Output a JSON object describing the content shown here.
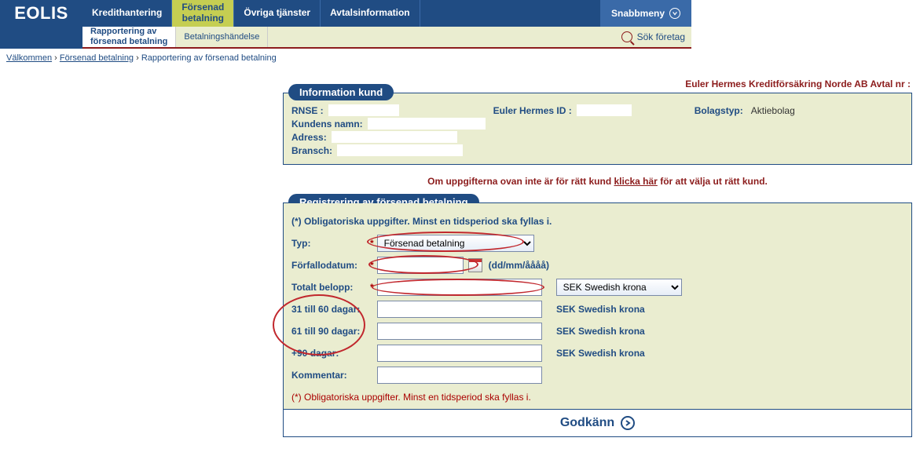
{
  "brand": "EOLIS",
  "nav": {
    "tabs": [
      {
        "label": "Kredithantering"
      },
      {
        "label_line1": "Försenad",
        "label_line2": "betalning"
      },
      {
        "label": "Övriga tjänster"
      },
      {
        "label": "Avtalsinformation"
      }
    ],
    "quickmenu": "Snabbmeny"
  },
  "subnav": {
    "tabs": [
      {
        "line1": "Rapportering av",
        "line2": "försenad betalning"
      },
      {
        "line1": "Betalningshändelse"
      }
    ],
    "search_company": "Sök företag"
  },
  "breadcrumb": {
    "a": "Välkommen",
    "b": "Försenad betalning",
    "c": "Rapportering av försenad betalning"
  },
  "topright": "Euler Hermes Kreditförsäkring Norde AB Avtal nr :",
  "panel_info": {
    "title": "Information kund",
    "rnse": "RNSE :",
    "ehid": "Euler Hermes ID :",
    "bolagstyp_label": "Bolagstyp:",
    "bolagstyp_value": "Aktiebolag",
    "kundnamn": "Kundens namn:",
    "adress": "Adress:",
    "bransch": "Bransch:"
  },
  "helper": {
    "p1": "Om uppgifterna ovan inte är för rätt kund ",
    "link": "klicka här",
    "p2": " för att välja ut rätt kund."
  },
  "panel_form": {
    "title": "Registrering av försenad betalning",
    "mandatory": "(*) Obligatoriska uppgifter. Minst en tidsperiod ska fyllas i.",
    "typ_label": "Typ:",
    "typ_value": "Försenad betalning",
    "forfall_label": "Förfallodatum:",
    "date_hint": "(dd/mm/åååå)",
    "total_label": "Totalt belopp:",
    "currency_select": "SEK Swedish krona",
    "r31": "31 till 60 dagar:",
    "r61": "61 till 90 dagar:",
    "r90": "+90 dagar:",
    "cur_static": "SEK Swedish krona",
    "kommentar": "Kommentar:",
    "mandatory_foot": "(*) Obligatoriska uppgifter. Minst en tidsperiod ska fyllas i.",
    "submit": "Godkänn"
  }
}
